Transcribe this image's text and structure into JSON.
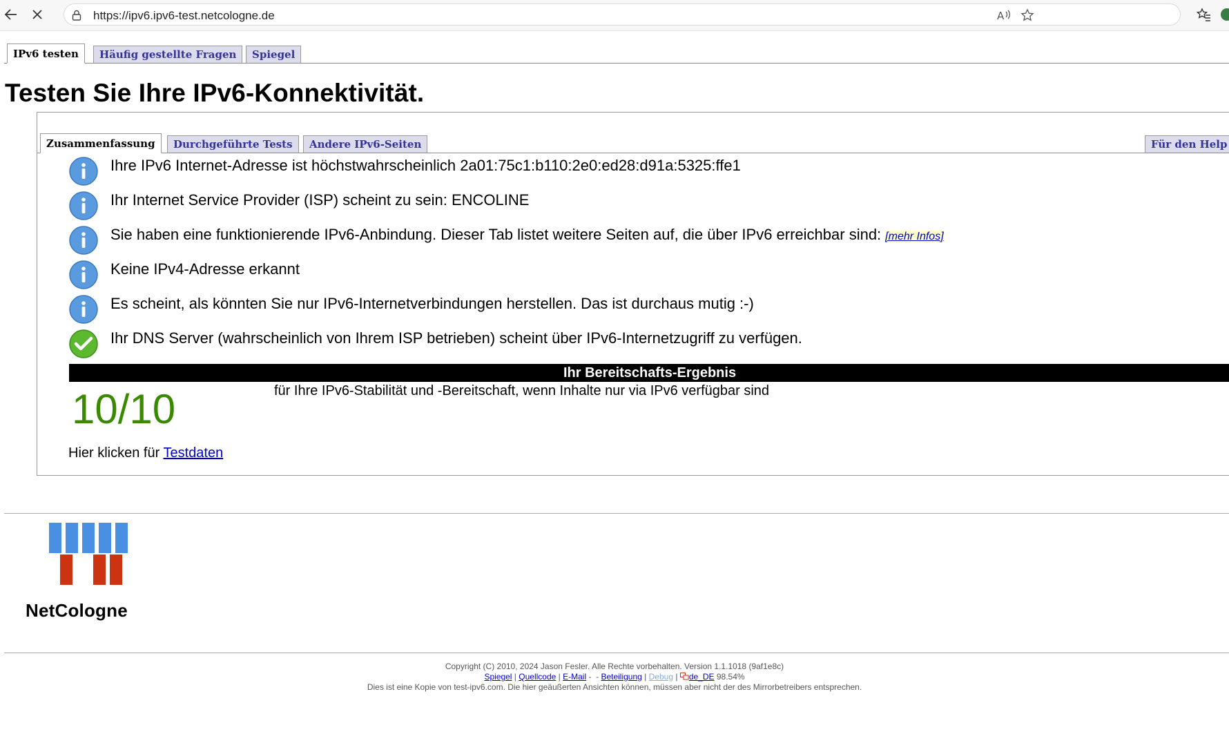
{
  "browser": {
    "url": "https://ipv6.ipv6-test.netcologne.de"
  },
  "top_tabs": [
    {
      "label": "IPv6 testen",
      "active": true
    },
    {
      "label": "Häufig gestellte Fragen",
      "active": false
    },
    {
      "label": "Spiegel",
      "active": false
    }
  ],
  "page_title": "Testen Sie Ihre IPv6-Konnektivität.",
  "sub_tabs": [
    {
      "label": "Zusammenfassung",
      "active": true
    },
    {
      "label": "Durchgeführte Tests",
      "active": false
    },
    {
      "label": "Andere IPv6-Seiten",
      "active": false
    },
    {
      "label": "Für den Help",
      "active": false
    }
  ],
  "results": [
    {
      "icon": "info-icon",
      "text": "Ihre IPv6 Internet-Adresse ist höchstwahrscheinlich 2a01:75c1:b110:2e0:ed28:d91a:5325:ffe1"
    },
    {
      "icon": "info-icon",
      "text": "Ihr Internet Service Provider (ISP) scheint zu sein: ENCOLINE"
    },
    {
      "icon": "info-icon",
      "text": "Sie haben eine funktionierende IPv6-Anbindung. Dieser Tab listet weitere Seiten auf, die über IPv6 erreichbar sind:",
      "link": "[mehr Infos]"
    },
    {
      "icon": "info-icon",
      "text": "Keine IPv4-Adresse erkannt"
    },
    {
      "icon": "info-icon",
      "text": "Es scheint, als könnten Sie nur IPv6-Internetverbindungen herstellen. Das ist durchaus mutig :-)"
    },
    {
      "icon": "check-icon",
      "text": "Ihr DNS Server (wahrscheinlich von Ihrem ISP betrieben) scheint über IPv6-Internetzugriff zu verfügen."
    }
  ],
  "readiness": {
    "header": "Ihr Bereitschafts-Ergebnis",
    "score": "10/10",
    "description": "für Ihre IPv6-Stabilität und -Bereitschaft, wenn Inhalte nur via IPv6 verfügbar sind"
  },
  "test_data": {
    "prefix": "Hier klicken für",
    "link": "Testdaten"
  },
  "logo": {
    "text": "NetCologne",
    "colors": {
      "blue": "#4a90e2",
      "red": "#cc3311"
    }
  },
  "footer": {
    "copyright": "Copyright (C) 2010, 2024 Jason Fesler. Alle Rechte vorbehalten. Version 1.1.1018 (9af1e8c)",
    "links": {
      "mirror": "Spiegel",
      "source": "Quellcode",
      "email": "E-Mail",
      "participation": "Beteiligung",
      "debug": "Debug",
      "locale": "de_DE",
      "percent": "98.54%"
    },
    "note": "Dies ist eine Kopie von test-ipv6.com. Die hier geäußerten Ansichten können, müssen aber nicht der des Mirrorbetreibers entsprechen."
  }
}
